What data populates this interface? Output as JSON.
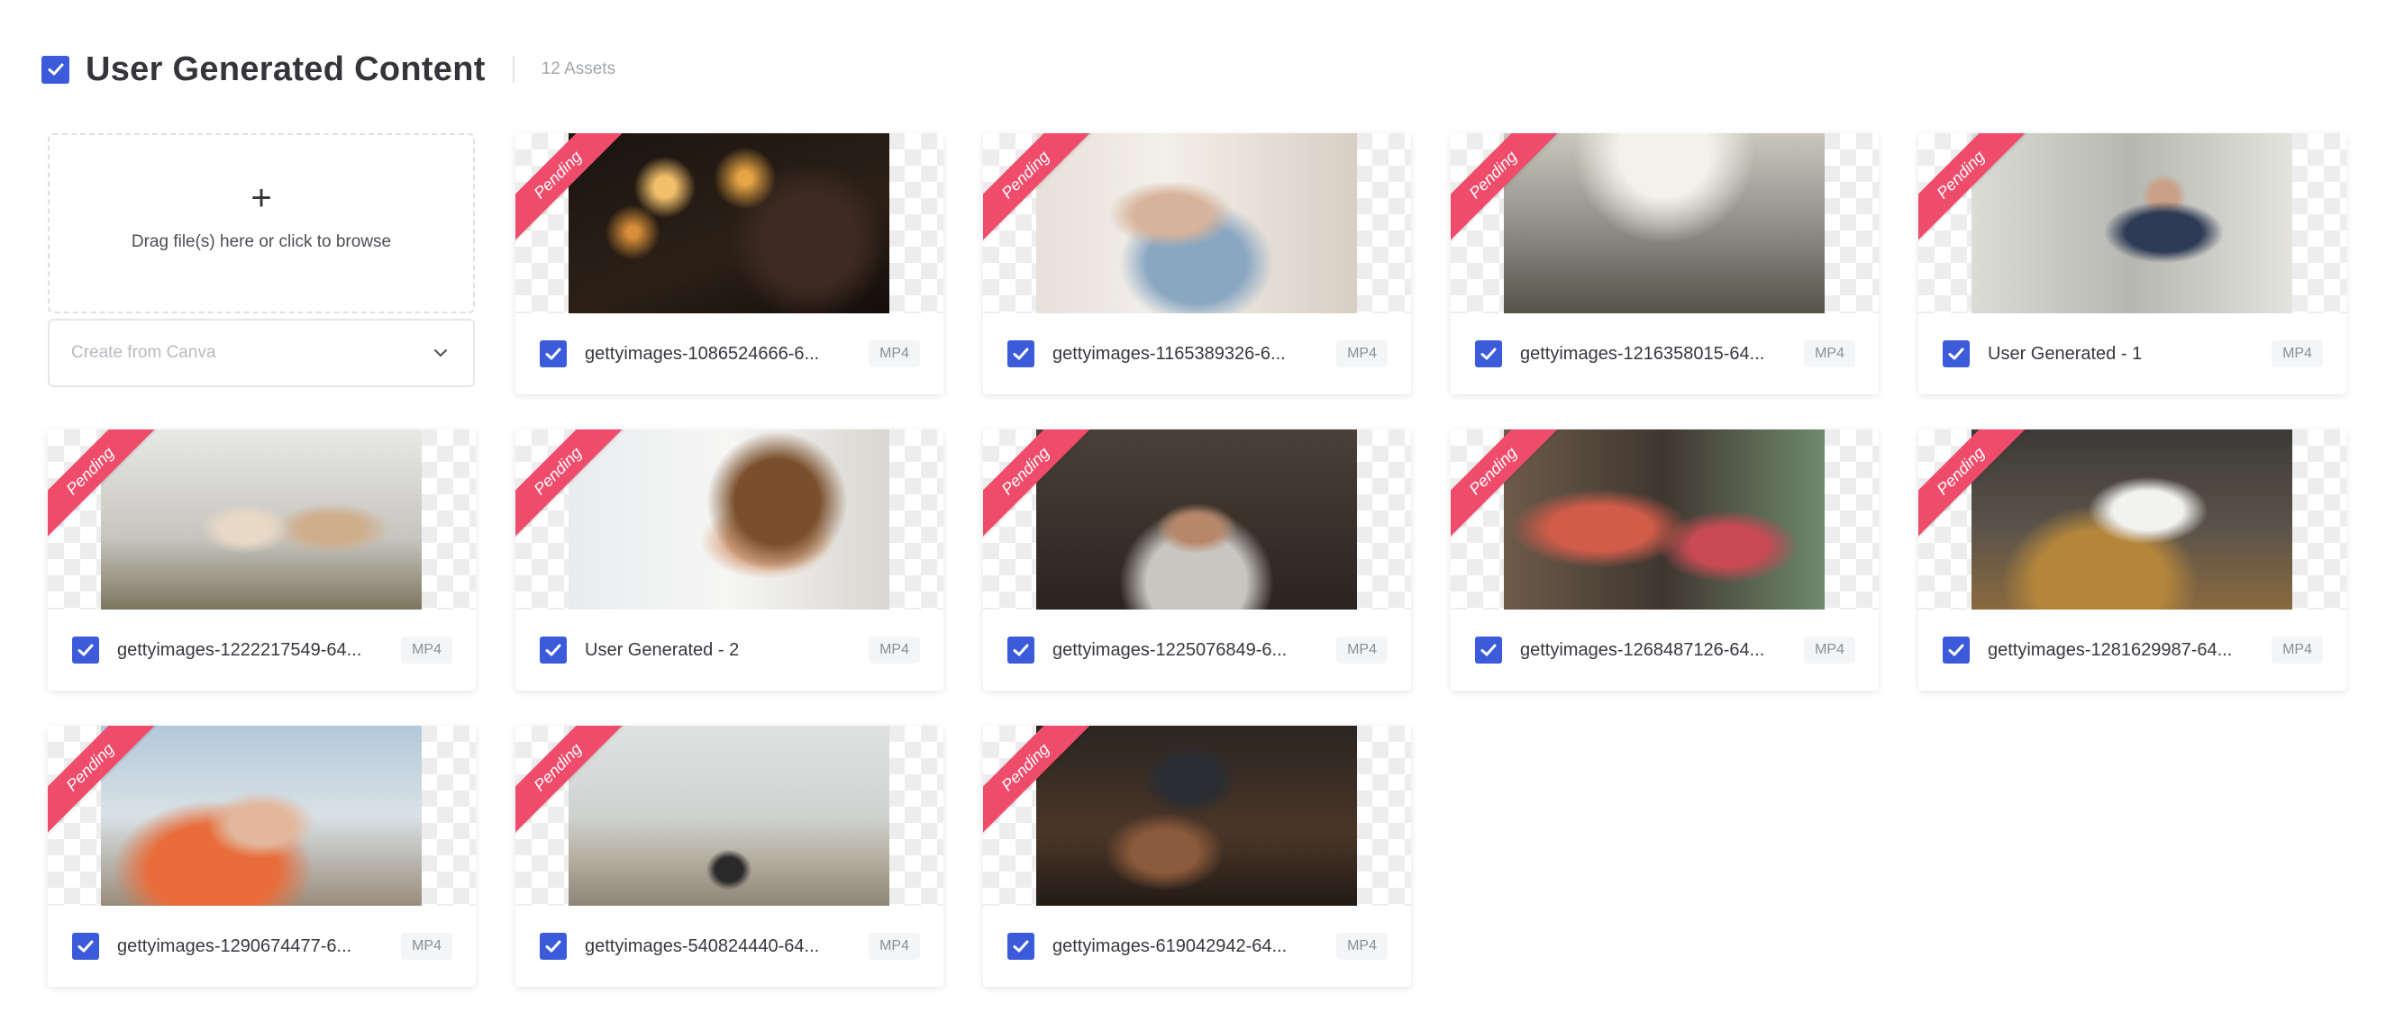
{
  "section": {
    "title": "User Generated Content",
    "asset_count": "12 Assets",
    "checked": true
  },
  "upload": {
    "plus": "+",
    "hint": "Drag file(s) here or click to browse"
  },
  "canva": {
    "placeholder": "Create from Canva"
  },
  "colors": {
    "accent": "#3b5bdb",
    "pending_ribbon": "#ef4c6b",
    "title_text": "#33353a"
  },
  "assets": [
    {
      "name": "gettyimages-1086524666-6...",
      "format": "MP4",
      "status": "Pending",
      "checked": true,
      "scene": "fireworks filmed on a phone at night"
    },
    {
      "name": "gettyimages-1165389326-6...",
      "format": "MP4",
      "status": "Pending",
      "checked": true,
      "scene": "woman holding lipstick recording with phone on tripod"
    },
    {
      "name": "gettyimages-1216358015-64...",
      "format": "MP4",
      "status": "Pending",
      "checked": true,
      "scene": "kids riding scooters on a sunny street"
    },
    {
      "name": "User Generated - 1",
      "format": "MP4",
      "status": "Pending",
      "checked": true,
      "scene": "man recording a vlog at a desk"
    },
    {
      "name": "gettyimages-1222217549-64...",
      "format": "MP4",
      "status": "Pending",
      "checked": true,
      "scene": "two women filming in a kitchen"
    },
    {
      "name": "User Generated - 2",
      "format": "MP4",
      "status": "Pending",
      "checked": true,
      "scene": "curly haired girl eating a snack"
    },
    {
      "name": "gettyimages-1225076849-6...",
      "format": "MP4",
      "status": "Pending",
      "checked": true,
      "scene": "woman meditating in front of a phone"
    },
    {
      "name": "gettyimages-1268487126-64...",
      "format": "MP4",
      "status": "Pending",
      "checked": true,
      "scene": "father and daughter at a window"
    },
    {
      "name": "gettyimages-1281629987-64...",
      "format": "MP4",
      "status": "Pending",
      "checked": true,
      "scene": "bearded chef cooking on camera"
    },
    {
      "name": "gettyimages-1290674477-6...",
      "format": "MP4",
      "status": "Pending",
      "checked": true,
      "scene": "woman in beanie taking a selfie in snow"
    },
    {
      "name": "gettyimages-540824440-64...",
      "format": "MP4",
      "status": "Pending",
      "checked": true,
      "scene": "cyclist filming a beach boardwalk"
    },
    {
      "name": "gettyimages-619042942-64...",
      "format": "MP4",
      "status": "Pending",
      "checked": true,
      "scene": "hands holding a phone at dusk"
    }
  ]
}
